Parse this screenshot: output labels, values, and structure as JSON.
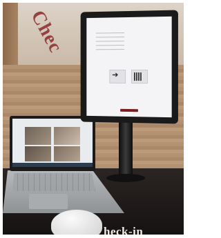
{
  "photo": {
    "wall_sign_text": "Chec",
    "desk_sign_text": "heck-in",
    "tablet": {
      "header": "",
      "prompt": "",
      "arrow_glyph": "➔"
    }
  }
}
